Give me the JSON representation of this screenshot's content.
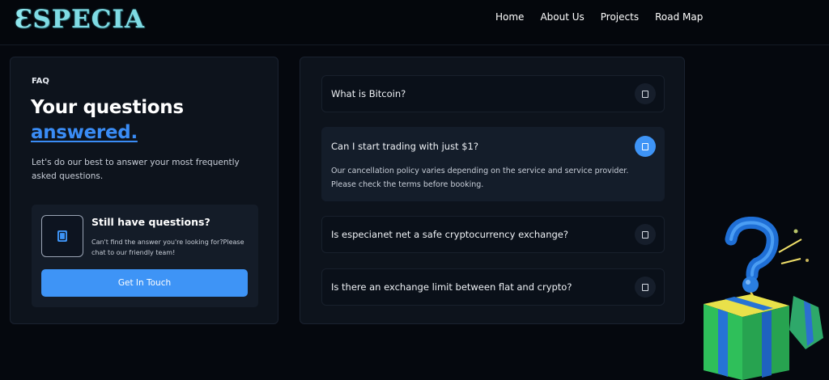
{
  "brand": {
    "logo_mark": "Ɛ",
    "logo_text": "SPECIA"
  },
  "nav": {
    "items": [
      {
        "label": "Home"
      },
      {
        "label": "About Us"
      },
      {
        "label": "Projects"
      },
      {
        "label": "Road Map"
      }
    ]
  },
  "faq_intro": {
    "label": "FAQ",
    "heading": "Your questions",
    "heading_accent": "answered.",
    "description": "Let's do our best to answer your most frequently asked questions."
  },
  "help_box": {
    "icon": "chat-icon",
    "title": "Still have questions?",
    "description": "Can't find the answer you're looking for?Please chat to our friendly team!",
    "button_label": "Get In Touch"
  },
  "faq": {
    "items": [
      {
        "question": "What is Bitcoin?",
        "answer": "",
        "open": false
      },
      {
        "question": "Can I start trading with just $1?",
        "answer": "Our cancellation policy varies depending on the service and service provider. Please check the terms before booking.",
        "open": true
      },
      {
        "question": "Is especianet net a safe cryptocurrency exchange?",
        "answer": "",
        "open": false
      },
      {
        "question": "Is there an exchange limit between flat and crypto?",
        "answer": "",
        "open": false
      }
    ]
  },
  "colors": {
    "accent": "#3e94f6",
    "background": "#05080e",
    "card": "#0d131c",
    "logo": "#7fdbe4"
  }
}
